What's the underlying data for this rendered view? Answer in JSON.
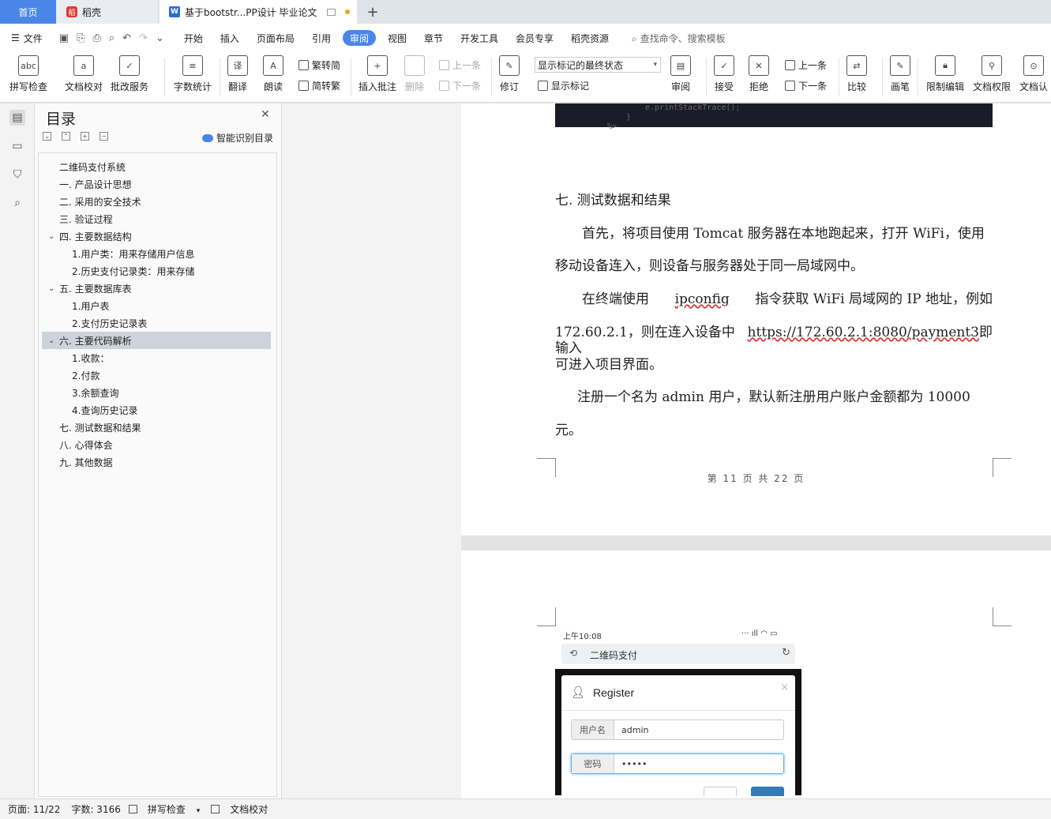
{
  "titlebar": {
    "home": "首页",
    "tab2": "稻壳",
    "tab2_icon": "daoke-icon",
    "tab3": "基于bootstr...PP设计 毕业论文",
    "tab3_icon": "wps-writer-icon",
    "add": "+"
  },
  "menubar": {
    "file": "文件",
    "items": [
      "开始",
      "插入",
      "页面布局",
      "引用",
      "审阅",
      "视图",
      "章节",
      "开发工具",
      "会员专享",
      "稻壳资源"
    ],
    "active": "审阅",
    "search": "查找命令、搜索模板"
  },
  "ribbon": {
    "spell": "拼写检查",
    "proof": "文档校对",
    "review_svc": "批改服务",
    "wordcount": "字数统计",
    "translate": "翻译",
    "read": "朗读",
    "t2s": "繁转简",
    "s2t": "简转繁",
    "comment": "插入批注",
    "delete": "删除",
    "prev_c": "上一条",
    "next_c": "下一条",
    "track": "修订",
    "markup_mode": "显示标记的最终状态",
    "show_markup": "显示标记",
    "review": "审阅",
    "accept": "接受",
    "reject": "拒绝",
    "prev": "上一条",
    "next": "下一条",
    "compare": "比较",
    "pen": "画笔",
    "restrict": "限制编辑",
    "perm": "文档权限",
    "auth": "文档认"
  },
  "toc": {
    "title": "目录",
    "smart": "智能识别目录",
    "items": [
      {
        "t": "二维码支付系统",
        "lvl": 1,
        "ch": ""
      },
      {
        "t": "一. 产品设计思想",
        "lvl": 1,
        "ch": ""
      },
      {
        "t": "二. 采用的安全技术",
        "lvl": 1,
        "ch": ""
      },
      {
        "t": "三. 验证过程",
        "lvl": 1,
        "ch": ""
      },
      {
        "t": "四. 主要数据结构",
        "lvl": 1,
        "ch": "v"
      },
      {
        "t": "1.用户类：用来存储用户信息",
        "lvl": 2,
        "ch": ""
      },
      {
        "t": "2.历史支付记录类：用来存储",
        "lvl": 2,
        "ch": ""
      },
      {
        "t": "五. 主要数据库表",
        "lvl": 1,
        "ch": "v"
      },
      {
        "t": "1.用户表",
        "lvl": 2,
        "ch": ""
      },
      {
        "t": "2.支付历史记录表",
        "lvl": 2,
        "ch": ""
      },
      {
        "t": "六. 主要代码解析",
        "lvl": 1,
        "ch": "v",
        "sel": true
      },
      {
        "t": "1.收款：",
        "lvl": 2,
        "ch": ""
      },
      {
        "t": "2.付款",
        "lvl": 2,
        "ch": ""
      },
      {
        "t": "3.余额查询",
        "lvl": 2,
        "ch": ""
      },
      {
        "t": "4.查询历史记录",
        "lvl": 2,
        "ch": ""
      },
      {
        "t": "七. 测试数据和结果",
        "lvl": 1,
        "ch": ""
      },
      {
        "t": "八. 心得体会",
        "lvl": 1,
        "ch": ""
      },
      {
        "t": "九. 其他数据",
        "lvl": 1,
        "ch": ""
      }
    ]
  },
  "doc": {
    "code_tail": [
      "e.printStackTrace();",
      "}",
      "%>"
    ],
    "heading": "七. 测试数据和结果",
    "p1a": "首先，将项目使用 Tomcat 服务器在本地跑起来，打开 WiFi，使用",
    "p1b": "移动设备连入，则设备与服务器处于同一局域网中。",
    "p2a1": "在终端使用",
    "p2a2": "ipconfig",
    "p2a3": "指令获取 WiFi 局域网的 IP 地址，例如",
    "p2b1": "172.60.2.1，则在连入设备中输入",
    "p2b2": "https://172.60.2.1:8080/payment3",
    "p2b3": "即",
    "p2c": "可进入项目界面。",
    "p3a": "注册一个名为 admin 用户，默认新注册用户账户金额都为 10000",
    "p3b": "元。",
    "footer": "第 11 页 共 22 页",
    "shot": {
      "time": "上午10:08",
      "app": "二维码支付",
      "modal_title": "Register",
      "user_label": "用户名",
      "user_val": "admin",
      "pass_label": "密码",
      "pass_val": "•••••"
    }
  },
  "status": {
    "page": "页面: 11/22",
    "words": "字数: 3166",
    "spell": "拼写检查",
    "proof": "文档校对"
  }
}
